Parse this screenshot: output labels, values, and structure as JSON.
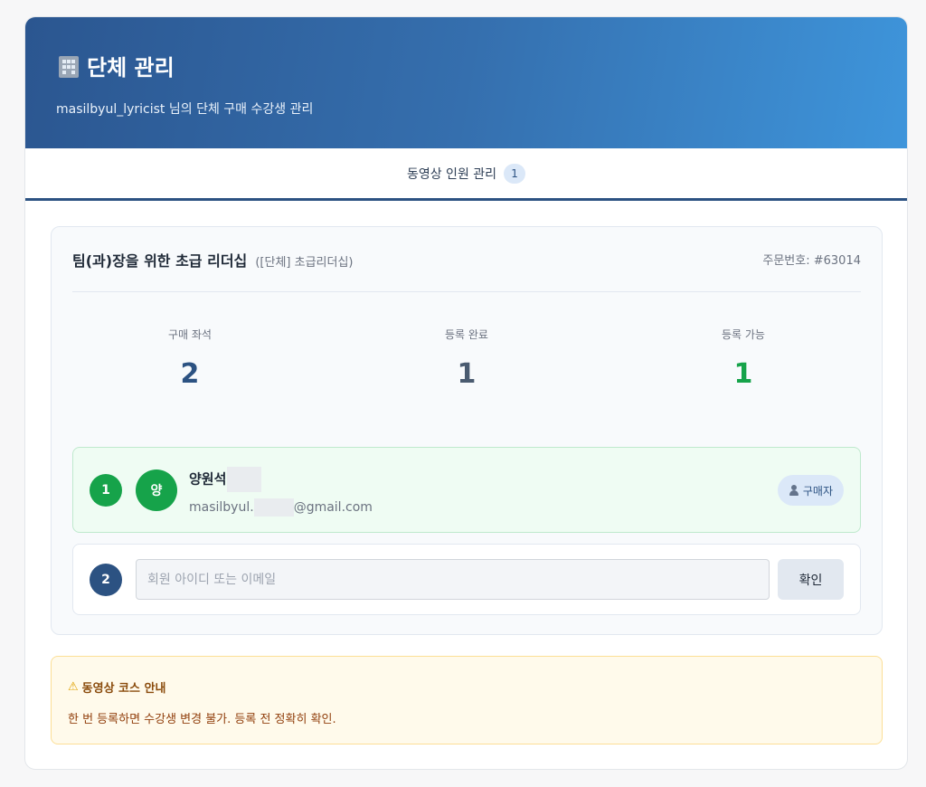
{
  "header": {
    "icon": "building-icon",
    "title": "단체 관리",
    "subtitle": "masilbyul_lyricist 님의 단체 구매 수강생 관리"
  },
  "tabs": [
    {
      "label": "동영상 인원 관리",
      "count": "1"
    }
  ],
  "course": {
    "title": "팀(과)장을 위한 초급 리더십",
    "tag": "([단체] 초급리더십)",
    "order_number": "주문번호: #63014",
    "stats": [
      {
        "label": "구매 좌석",
        "value": "2",
        "color": "#2c5282"
      },
      {
        "label": "등록 완료",
        "value": "1",
        "color": "#4a5b70"
      },
      {
        "label": "등록 가능",
        "value": "1",
        "color": "#16a34a"
      }
    ],
    "members": [
      {
        "number": "1",
        "avatar_initial": "양",
        "name": "양원석",
        "email_prefix": "masilbyul.",
        "email_suffix": "@gmail.com",
        "badge_icon": "person-icon",
        "badge": "구매자"
      }
    ],
    "new_slot": {
      "number": "2",
      "placeholder": "회원 아이디 또는 이메일",
      "button": "확인"
    }
  },
  "notice": {
    "icon": "warning-icon",
    "title": "동영상 코스 안내",
    "text": "한 번 등록하면 수강생 변경 불가. 등록 전 정확히 확인."
  },
  "colors": {
    "primary": "#2c5282",
    "success": "#16a34a",
    "warning_bg": "#fffaeb"
  }
}
